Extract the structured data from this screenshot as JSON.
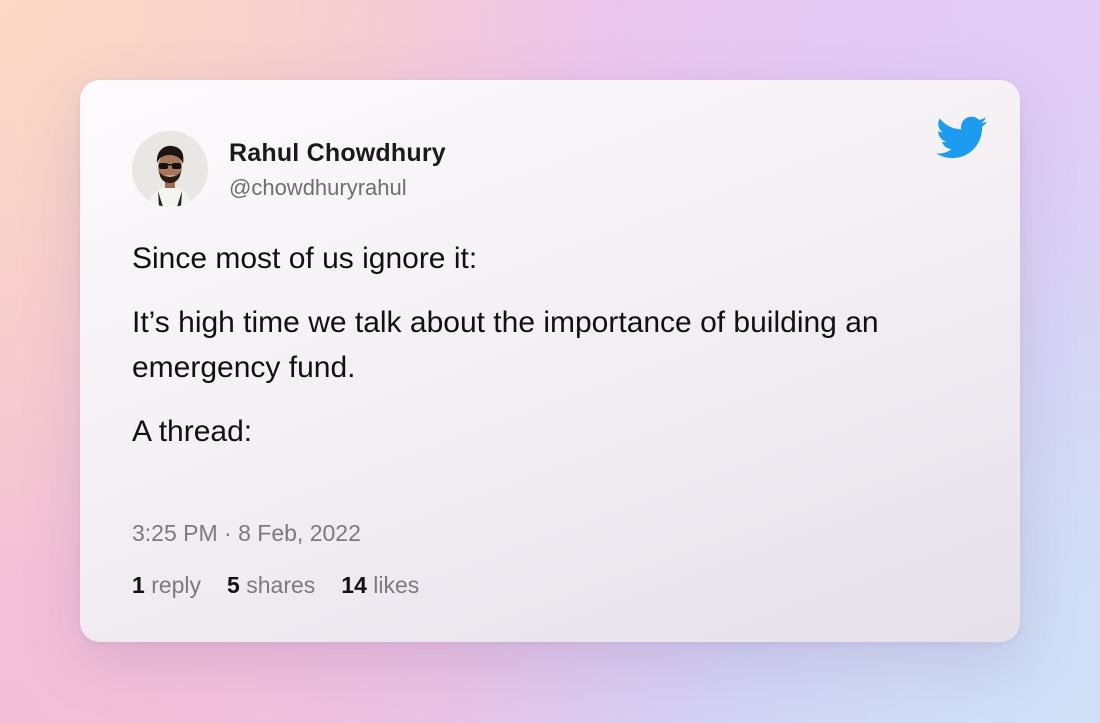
{
  "tweet": {
    "author": {
      "name": "Rahul Chowdhury",
      "handle": "@chowdhuryrahul"
    },
    "paragraphs": [
      "Since most of us ignore it:",
      "It’s high time we talk about the importance of building an emergency fund.",
      "A thread:"
    ],
    "timestamp": "3:25 PM · 8 Feb, 2022",
    "stats": {
      "replies": {
        "count": "1",
        "label": "reply"
      },
      "shares": {
        "count": "5",
        "label": "shares"
      },
      "likes": {
        "count": "14",
        "label": "likes"
      }
    }
  },
  "icons": {
    "brand": "twitter-bird-icon"
  },
  "colors": {
    "twitter_blue": "#1d9bf0",
    "text_primary": "#111111",
    "text_secondary": "#7a7a7f"
  }
}
